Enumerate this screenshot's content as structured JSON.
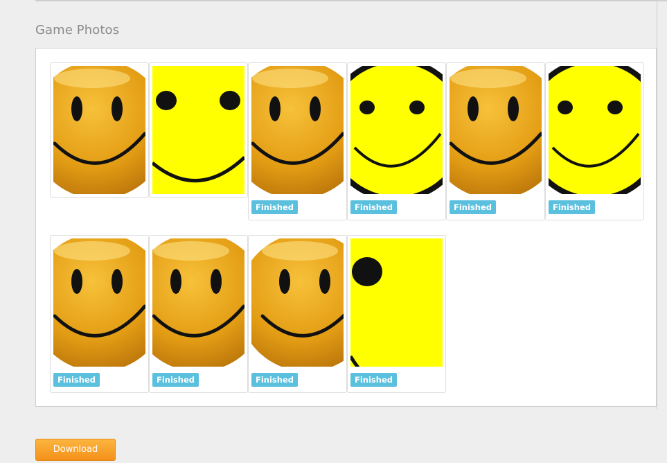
{
  "section": {
    "title": "Game Photos"
  },
  "photos": [
    {
      "style": "glossy-orange",
      "status": ""
    },
    {
      "style": "flat-yellow-crop",
      "status": ""
    },
    {
      "style": "glossy-orange",
      "status": "Finished"
    },
    {
      "style": "flat-yellow-outline",
      "status": "Finished"
    },
    {
      "style": "glossy-orange",
      "status": "Finished"
    },
    {
      "style": "flat-yellow-outline",
      "status": "Finished"
    },
    {
      "style": "glossy-orange",
      "status": "Finished"
    },
    {
      "style": "glossy-orange",
      "status": "Finished"
    },
    {
      "style": "glossy-orange-tilted",
      "status": "Finished"
    },
    {
      "style": "flat-yellow-zoom",
      "status": "Finished"
    }
  ],
  "actions": {
    "download_label": "Download"
  },
  "colors": {
    "badge": "#5bc0de",
    "download": "#f7a12b",
    "smiley_yellow": "#ffff00",
    "smiley_orange": "#e7a11a"
  }
}
